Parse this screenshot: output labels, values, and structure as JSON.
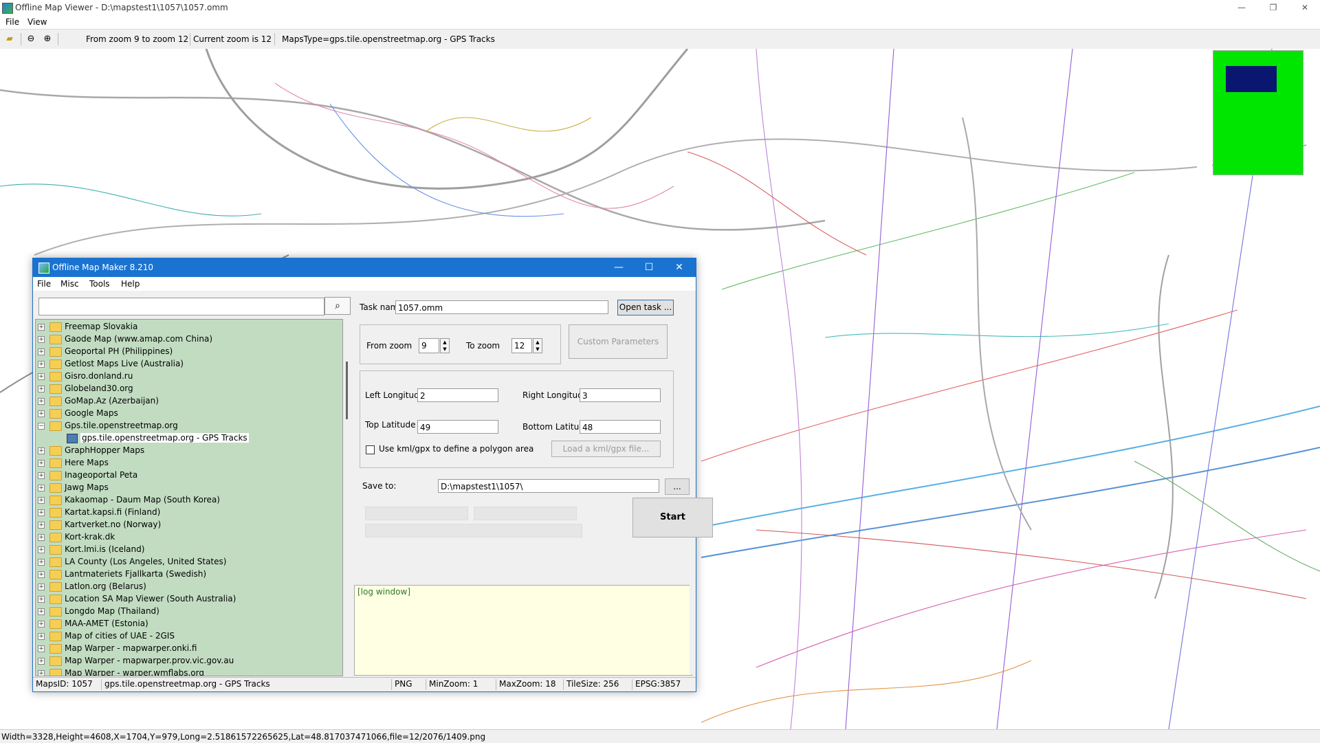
{
  "window": {
    "title": "Offline Map Viewer - D:\\mapstest1\\1057\\1057.omm",
    "controls": {
      "minimize": "—",
      "restore": "❐",
      "close": "✕"
    }
  },
  "menu": [
    "File",
    "View"
  ],
  "toolbar": {
    "zoom_range": "From zoom 9 to zoom 12",
    "current_zoom": "Current zoom is 12",
    "maps_type": "MapsType=gps.tile.openstreetmap.org - GPS Tracks"
  },
  "statusbar": "Width=3328,Height=4608,X=1704,Y=979,Long=2.51861572265625,Lat=48.817037471066,file=12/2076/1409.png",
  "overview": {
    "background": "#00e600",
    "viewport_color": "#0a1770"
  },
  "dialog": {
    "title": "Offline Map Maker 8.210",
    "menu": [
      "File",
      "Misc",
      "Tools",
      "Help"
    ],
    "search_placeholder": "",
    "tree": [
      {
        "label": "Freemap Slovakia",
        "expanded": false
      },
      {
        "label": "Gaode Map (www.amap.com China)",
        "expanded": false
      },
      {
        "label": "Geoportal PH (Philippines)",
        "expanded": false
      },
      {
        "label": "Getlost Maps Live (Australia)",
        "expanded": false
      },
      {
        "label": "Gisro.donland.ru",
        "expanded": false
      },
      {
        "label": "Globeland30.org",
        "expanded": false
      },
      {
        "label": "GoMap.Az (Azerbaijan)",
        "expanded": false
      },
      {
        "label": "Google Maps",
        "expanded": false
      },
      {
        "label": "Gps.tile.openstreetmap.org",
        "expanded": true
      },
      {
        "label": "gps.tile.openstreetmap.org - GPS Tracks",
        "child": true
      },
      {
        "label": "GraphHopper Maps",
        "expanded": false
      },
      {
        "label": "Here Maps",
        "expanded": false
      },
      {
        "label": "Inageoportal Peta",
        "expanded": false
      },
      {
        "label": "Jawg Maps",
        "expanded": false
      },
      {
        "label": "Kakaomap - Daum Map (South Korea)",
        "expanded": false
      },
      {
        "label": "Kartat.kapsi.fi (Finland)",
        "expanded": false
      },
      {
        "label": "Kartverket.no (Norway)",
        "expanded": false
      },
      {
        "label": "Kort-krak.dk",
        "expanded": false
      },
      {
        "label": "Kort.lmi.is (Iceland)",
        "expanded": false
      },
      {
        "label": "LA County (Los Angeles, United States)",
        "expanded": false
      },
      {
        "label": "Lantmateriets Fjallkarta (Swedish)",
        "expanded": false
      },
      {
        "label": "Latlon.org (Belarus)",
        "expanded": false
      },
      {
        "label": "Location SA Map Viewer (South Australia)",
        "expanded": false
      },
      {
        "label": "Longdo Map (Thailand)",
        "expanded": false
      },
      {
        "label": "MAA-AMET (Estonia)",
        "expanded": false
      },
      {
        "label": "Map of cities of UAE - 2GIS",
        "expanded": false
      },
      {
        "label": "Map Warper - mapwarper.onki.fi",
        "expanded": false
      },
      {
        "label": "Map Warper - mapwarper.prov.vic.gov.au",
        "expanded": false
      },
      {
        "label": "Map Warper - warper.wmflabs.org",
        "expanded": false
      }
    ],
    "task_name_label": "Task name",
    "task_name_value": "1057.omm",
    "open_task_label": "Open task ...",
    "from_zoom_label": "From zoom",
    "from_zoom_value": "9",
    "to_zoom_label": "To zoom",
    "to_zoom_value": "12",
    "custom_params_label": "Custom Parameters",
    "left_lon_label": "Left Longitude",
    "left_lon_value": "2",
    "right_lon_label": "Right Longitude",
    "right_lon_value": "3",
    "top_lat_label": "Top Latitude",
    "top_lat_value": "49",
    "bottom_lat_label": "Bottom Latitude",
    "bottom_lat_value": "48",
    "kml_check_label": "Use kml/gpx to define a polygon area",
    "load_kml_label": "Load a kml/gpx file...",
    "save_to_label": "Save to:",
    "save_to_value": "D:\\mapstest1\\1057\\",
    "browse_label": "...",
    "start_label": "Start",
    "log_text": "[log window]",
    "status": {
      "maps_id": "MapsID: 1057",
      "maps_name": "gps.tile.openstreetmap.org - GPS Tracks",
      "format": "PNG",
      "min_zoom": "MinZoom: 1",
      "max_zoom": "MaxZoom: 18",
      "tile_size": "TileSize: 256",
      "epsg": "EPSG:3857"
    }
  }
}
